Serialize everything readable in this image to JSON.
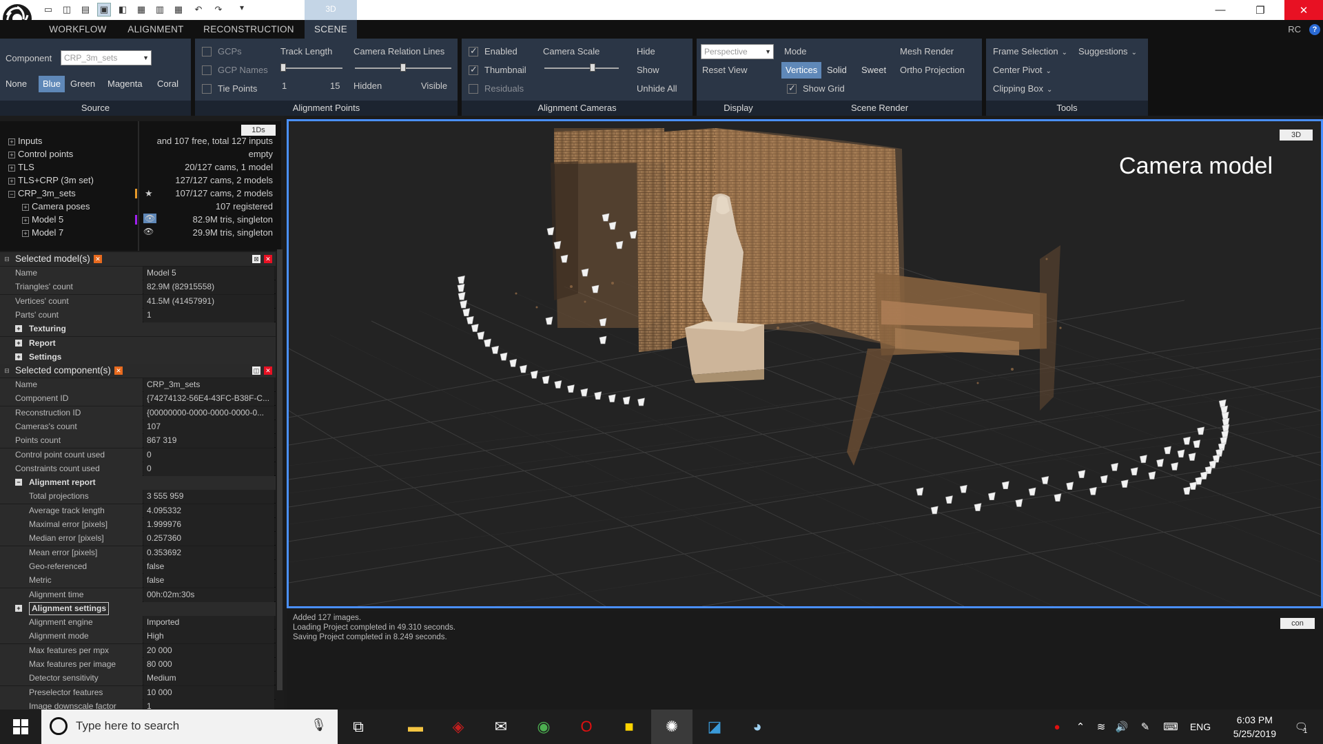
{
  "titlebar": {
    "context_tab": "3D",
    "icons": [
      "layout-1-icon",
      "layout-2-icon",
      "layout-3-icon",
      "layout-4-icon",
      "layout-5-icon",
      "layout-6-icon",
      "layout-7-icon",
      "layout-8-icon",
      "layout-9-icon",
      "undo-icon",
      "redo-icon"
    ]
  },
  "menu": {
    "tabs": [
      "WORKFLOW",
      "ALIGNMENT",
      "RECONSTRUCTION",
      "SCENE"
    ],
    "active": "SCENE",
    "right_label": "RC",
    "help": "?"
  },
  "ribbon": {
    "source": {
      "title": "Source",
      "component_label": "Component",
      "component_value": "CRP_3m_sets",
      "colors": [
        "None",
        "Blue",
        "Green",
        "Magenta",
        "Coral"
      ],
      "selected_color": "Blue"
    },
    "alignment_points": {
      "title": "Alignment Points",
      "gcps": "GCPs",
      "gcp_names": "GCP Names",
      "tie_points": "Tie Points",
      "track_length": "Track Length",
      "track_min": "1",
      "track_max": "15",
      "camera_relation_lines": "Camera Relation Lines",
      "hidden": "Hidden",
      "visible": "Visible"
    },
    "alignment_cameras": {
      "title": "Alignment Cameras",
      "enabled": "Enabled",
      "thumbnail": "Thumbnail",
      "residuals": "Residuals",
      "camera_scale": "Camera Scale",
      "hide": "Hide",
      "show": "Show",
      "unhide_all": "Unhide All"
    },
    "display": {
      "title": "Display",
      "projection": "Perspective",
      "reset_view": "Reset View"
    },
    "scene_render": {
      "title": "Scene Render",
      "mode": "Mode",
      "modes": [
        "Vertices",
        "Solid",
        "Sweet"
      ],
      "selected_mode": "Vertices",
      "mesh_render": "Mesh Render",
      "ortho_projection": "Ortho Projection",
      "show_grid": "Show Grid"
    },
    "tools": {
      "title": "Tools",
      "frame_selection": "Frame Selection",
      "suggestions": "Suggestions",
      "center_pivot": "Center Pivot",
      "clipping_box": "Clipping Box"
    }
  },
  "tree": {
    "badge": "1Ds",
    "rows": [
      {
        "label": "Inputs",
        "info": "and 107 free, total 127 inputs",
        "indent": 0
      },
      {
        "label": "Control points",
        "info": "empty",
        "indent": 0
      },
      {
        "label": "TLS",
        "info": "20/127 cams, 1 model",
        "indent": 0
      },
      {
        "label": "TLS+CRP (3m set)",
        "info": "127/127 cams, 2 models",
        "indent": 0
      },
      {
        "label": "CRP_3m_sets",
        "info": "107/127 cams, 2 models",
        "indent": 0
      },
      {
        "label": "Camera poses",
        "info": "107 registered",
        "indent": 1
      },
      {
        "label": "Model 5",
        "info": "82.9M tris, singleton",
        "indent": 1
      },
      {
        "label": "Model 7",
        "info": "29.9M tris, singleton",
        "indent": 1
      }
    ]
  },
  "selected_model": {
    "title": "Selected model(s)",
    "rows": [
      {
        "k": "Name",
        "v": "Model 5"
      },
      {
        "k": "Triangles' count",
        "v": "82.9M (82915558)"
      },
      {
        "k": "Vertices' count",
        "v": "41.5M (41457991)"
      },
      {
        "k": "Parts' count",
        "v": "1"
      }
    ],
    "subsections": [
      "Texturing",
      "Report",
      "Settings"
    ]
  },
  "selected_component": {
    "title": "Selected component(s)",
    "rows": [
      {
        "k": "Name",
        "v": "CRP_3m_sets"
      },
      {
        "k": "Component ID",
        "v": "{74274132-56E4-43FC-B38F-C..."
      },
      {
        "k": "Reconstruction ID",
        "v": "{00000000-0000-0000-0000-0..."
      },
      {
        "k": "Cameras's count",
        "v": "107"
      },
      {
        "k": "Points count",
        "v": "867 319"
      },
      {
        "k": "Control point count used",
        "v": "0"
      },
      {
        "k": "Constraints count used",
        "v": "0"
      }
    ],
    "alignment_report_title": "Alignment report",
    "alignment_report": [
      {
        "k": "Total projections",
        "v": "3 555 959"
      },
      {
        "k": "Average track length",
        "v": "4.095332"
      },
      {
        "k": "Maximal error [pixels]",
        "v": "1.999976"
      },
      {
        "k": "Median error [pixels]",
        "v": "0.257360"
      },
      {
        "k": "Mean error [pixels]",
        "v": "0.353692"
      },
      {
        "k": "Geo-referenced",
        "v": "false"
      },
      {
        "k": "Metric",
        "v": "false"
      },
      {
        "k": "Alignment time",
        "v": "00h:02m:30s"
      }
    ],
    "alignment_settings_title": "Alignment settings",
    "alignment_settings": [
      {
        "k": "Alignment engine",
        "v": "Imported"
      },
      {
        "k": "Alignment mode",
        "v": "High"
      },
      {
        "k": "Max features per mpx",
        "v": "20 000"
      },
      {
        "k": "Max features per image",
        "v": "80 000"
      },
      {
        "k": "Detector sensitivity",
        "v": "Medium"
      },
      {
        "k": "Preselector features",
        "v": "10 000"
      },
      {
        "k": "Image downscale factor",
        "v": "1"
      }
    ]
  },
  "viewport": {
    "label": "Camera model",
    "badge": "3D"
  },
  "log": {
    "badge": "con",
    "lines": [
      "Added 127 images.",
      "Loading Project completed in 49.310 seconds.",
      "Saving Project completed in 8.249 seconds."
    ]
  },
  "taskbar": {
    "search_placeholder": "Type here to search",
    "language": "ENG",
    "time": "6:03 PM",
    "date": "5/25/2019",
    "notification_count": "1",
    "apps": [
      "task-view-icon",
      "file-explorer-icon",
      "mcafee-icon",
      "mail-icon",
      "chrome-icon",
      "opera-icon",
      "sticky-notes-icon",
      "realitycapture-icon",
      "app-icon",
      "paint-icon"
    ]
  },
  "colors": {
    "accent": "#4a90ff",
    "ribbon_bg": "#2b3646",
    "selected_chip": "#5f88b8",
    "close_red": "#e81123"
  }
}
